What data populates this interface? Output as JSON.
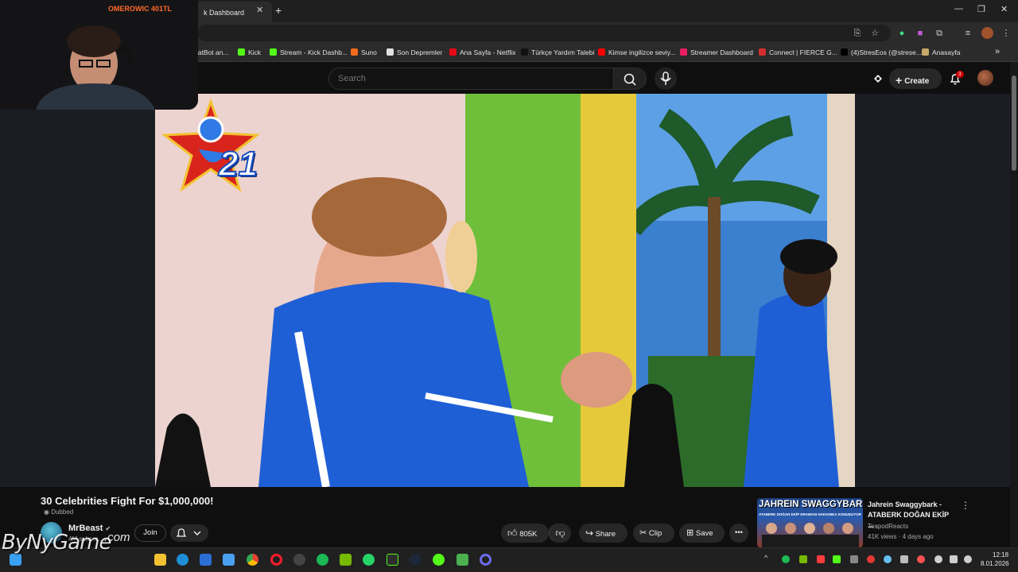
{
  "browser": {
    "active_tab_title": "k Dashboard",
    "new_tab_label": "+",
    "close_label": "✕"
  },
  "bookmarks": [
    {
      "label": "hatBot an...",
      "color": "#1f1f1f"
    },
    {
      "label": "Kick",
      "color": "#53fc18"
    },
    {
      "label": "Stream - Kick Dashb...",
      "color": "#53fc18"
    },
    {
      "label": "Suno",
      "color": "#f26b1d"
    },
    {
      "label": "Son Depremler",
      "color": "#e0e0e0"
    },
    {
      "label": "Ana Sayfa - Netflix",
      "color": "#e50914"
    },
    {
      "label": "Türkçe Yardım Talebi",
      "color": "#111111"
    },
    {
      "label": "Kimse ingilizce seviy...",
      "color": "#ff0000"
    },
    {
      "label": "Streamer Dashboard",
      "color": "#e91e63"
    },
    {
      "label": "Connect | FIERCE G...",
      "color": "#d32f2f"
    },
    {
      "label": "(4)StresEos (@strese...",
      "color": "#000000"
    },
    {
      "label": "Anasayfa",
      "color": "#c8a96a"
    }
  ],
  "overlay": {
    "text": "OMEROWIC 401TL"
  },
  "youtube": {
    "search_placeholder": "Search",
    "create_label": "Create",
    "notification_count": "3"
  },
  "video": {
    "title": "30 Celebrities Fight For $1,000,000!",
    "dubbed_label": "Dubbed",
    "channel_name": "MrBeast",
    "subscribers": "4M subscr...",
    "join_label": "Join",
    "like_count": "805K",
    "share_label": "Share",
    "clip_label": "Clip",
    "save_label": "Save",
    "badge_number": "21"
  },
  "recommendation": {
    "thumb_text": "JAHREIN SWAGGYBARK",
    "thumb_subtext": "ATABERK DOĞAN EKİP DRAMASI HAKKINDA KONUŞUYOR",
    "title": "Jahrein Swaggybark - ATABERK DOĞAN EKİP ...",
    "channel": "TeapodReacts",
    "meta": "41K views · 4 days ago"
  },
  "taskbar": {
    "time": "12:18",
    "date": "8.01.2026"
  },
  "watermark": {
    "text": "ByNyGame",
    "suffix": ".com"
  }
}
